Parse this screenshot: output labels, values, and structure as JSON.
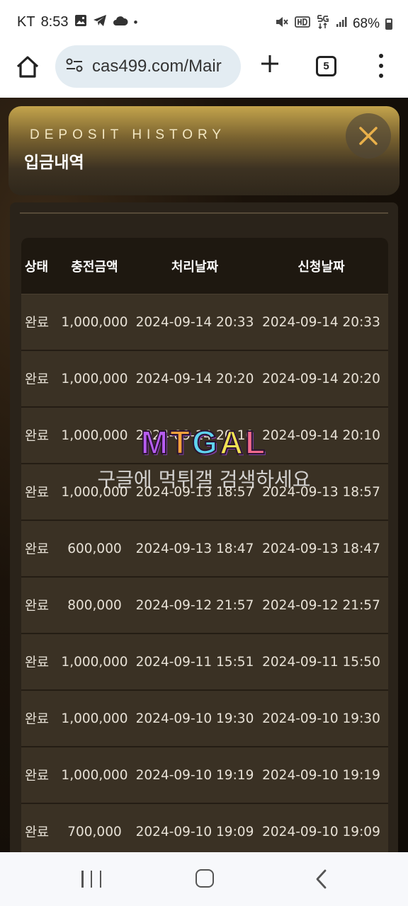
{
  "status_bar": {
    "carrier": "KT",
    "time": "8:53",
    "battery": "68%",
    "left_icons": [
      "image-icon",
      "telegram-icon",
      "cloud-icon",
      "dot-icon"
    ],
    "right_icons": [
      "mute-icon",
      "hd-icon",
      "5g-icon",
      "signal-icon",
      "battery-icon"
    ]
  },
  "browser": {
    "url": "cas499.com/Mair",
    "tab_count": "5"
  },
  "modal": {
    "eyebrow": "DEPOSIT HISTORY",
    "title": "입금내역"
  },
  "table": {
    "headers": [
      "상태",
      "충전금액",
      "처리날짜",
      "신청날짜"
    ],
    "rows": [
      {
        "status": "완료",
        "amount": "1,000,000",
        "processed": "2024-09-14 20:33",
        "requested": "2024-09-14 20:33"
      },
      {
        "status": "완료",
        "amount": "1,000,000",
        "processed": "2024-09-14 20:20",
        "requested": "2024-09-14 20:20"
      },
      {
        "status": "완료",
        "amount": "1,000,000",
        "processed": "2024-09-14 20:10",
        "requested": "2024-09-14 20:10"
      },
      {
        "status": "완료",
        "amount": "1,000,000",
        "processed": "2024-09-13 18:57",
        "requested": "2024-09-13 18:57"
      },
      {
        "status": "완료",
        "amount": "600,000",
        "processed": "2024-09-13 18:47",
        "requested": "2024-09-13 18:47"
      },
      {
        "status": "완료",
        "amount": "800,000",
        "processed": "2024-09-12 21:57",
        "requested": "2024-09-12 21:57"
      },
      {
        "status": "완료",
        "amount": "1,000,000",
        "processed": "2024-09-11 15:51",
        "requested": "2024-09-11 15:50"
      },
      {
        "status": "완료",
        "amount": "1,000,000",
        "processed": "2024-09-10 19:30",
        "requested": "2024-09-10 19:30"
      },
      {
        "status": "완료",
        "amount": "1,000,000",
        "processed": "2024-09-10 19:19",
        "requested": "2024-09-10 19:19"
      },
      {
        "status": "완료",
        "amount": "700,000",
        "processed": "2024-09-10 19:09",
        "requested": "2024-09-10 19:09"
      }
    ]
  },
  "watermark": {
    "logo_letters": [
      "M",
      "T",
      "G",
      "A",
      "L"
    ],
    "caption": "구글에 먹튀갤 검색하세요"
  },
  "colors": {
    "header_gold": "#c4a44c",
    "row_bg": "#3a3124",
    "header_row_bg": "#1e1810",
    "modal_body": "#2a231a"
  }
}
